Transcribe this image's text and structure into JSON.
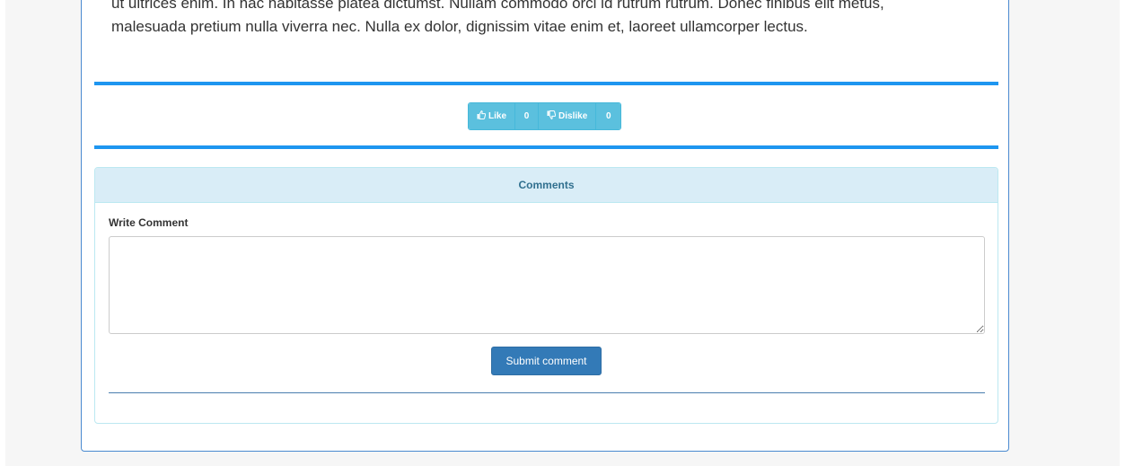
{
  "article": {
    "line1": "ut ultrices enim. In hac habitasse platea dictumst. Nullam commodo orci id rutrum rutrum. Donec finibus elit metus,",
    "line2": "malesuada pretium nulla viverra nec. Nulla ex dolor, dignissim vitae enim et, laoreet ullamcorper lectus."
  },
  "votes": {
    "like_label": "Like",
    "like_count": "0",
    "dislike_label": "Dislike",
    "dislike_count": "0"
  },
  "comments": {
    "heading": "Comments",
    "write_label": "Write Comment",
    "textarea_value": "",
    "submit_label": "Submit comment"
  },
  "colors": {
    "accent_bar": "#1e96f0",
    "vote_button": "#5bc0de",
    "panel_heading_bg": "#d9edf7",
    "panel_heading_text": "#31708f",
    "submit_button": "#337ab7"
  }
}
